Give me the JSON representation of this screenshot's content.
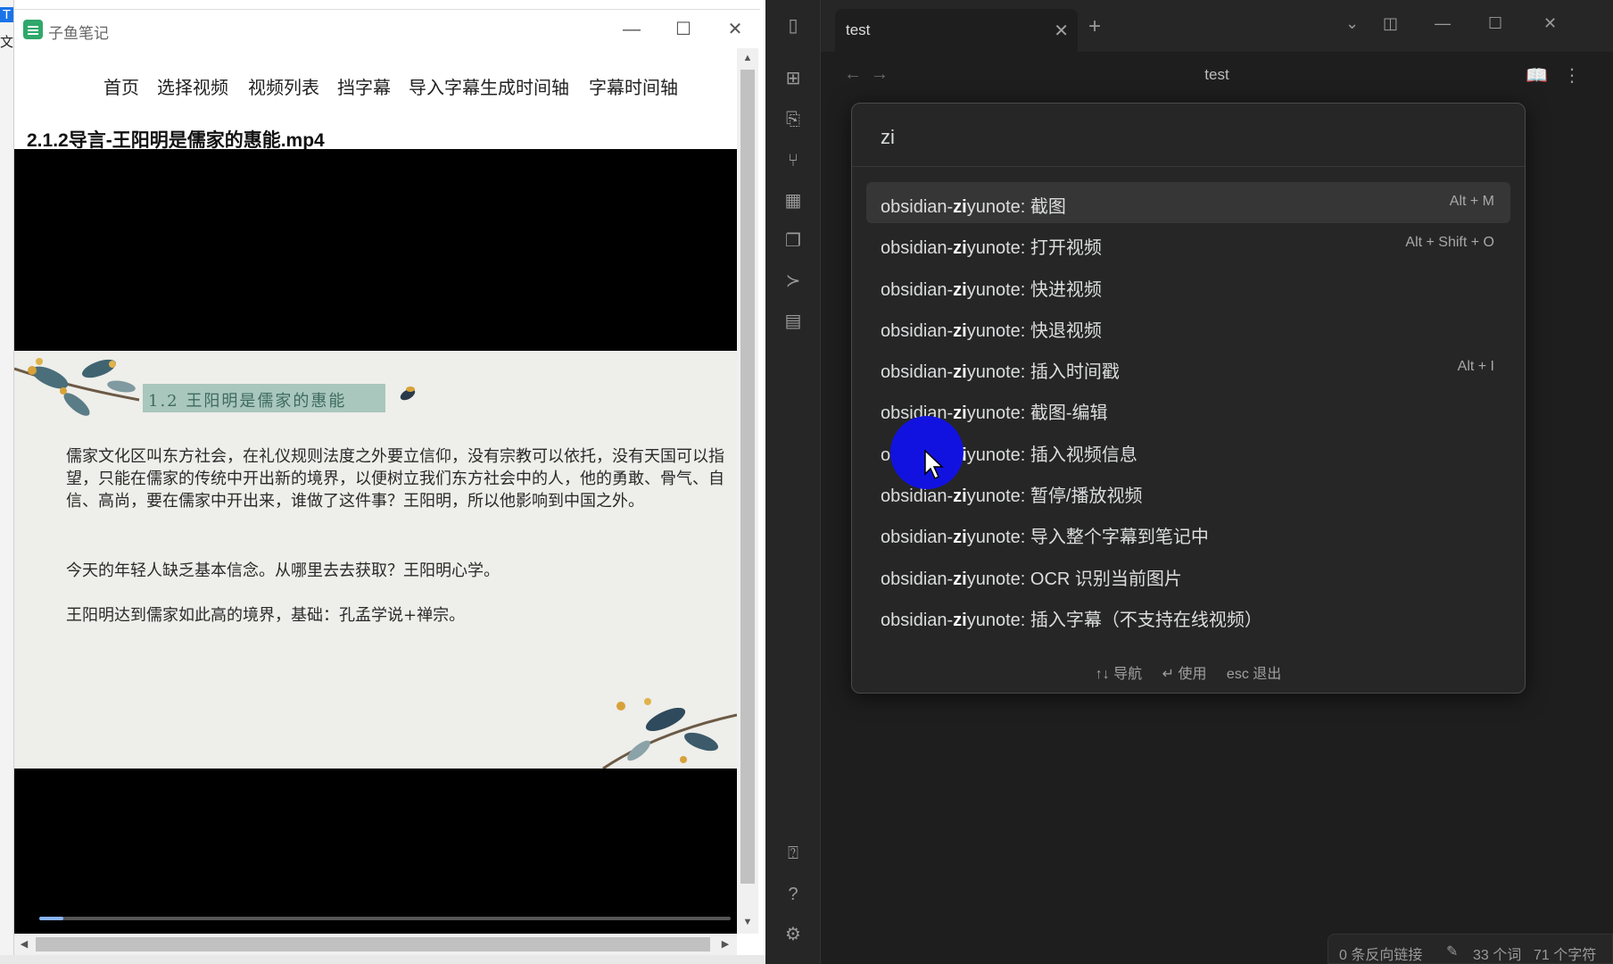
{
  "left_app": {
    "title": "子鱼笔记",
    "edge_chars": [
      "T",
      "文"
    ],
    "nav": [
      "首页",
      "选择视频",
      "视频列表",
      "挡字幕",
      "导入字幕生成时间轴",
      "字幕时间轴"
    ],
    "video_title": "2.1.2导言-王阳明是儒家的惠能.mp4",
    "slide": {
      "heading": "1.2 王阳明是儒家的惠能",
      "paragraph_1": "儒家文化区叫东方社会，在礼仪规则法度之外要立信仰，没有宗教可以依托，没有天国可以指望，只能在儒家的传统中开出新的境界，以便树立我们东方社会中的人，他的勇敢、骨气、自信、高尚，要在儒家中开出来，谁做了这件事？王阳明，所以他影响到中国之外。",
      "paragraph_2": "今天的年轻人缺乏基本信念。从哪里去去获取？王阳明心学。",
      "paragraph_3": "王阳明达到儒家如此高的境界，基础：孔孟学说+禅宗。"
    },
    "playback_progress": 0.035
  },
  "obsidian": {
    "tab": {
      "label": "test"
    },
    "view_title": "test",
    "palette": {
      "query": "zi",
      "commands": [
        {
          "prefix": "obsidian-",
          "match": "zi",
          "suffix": "yunote: 截图",
          "hotkey": "Alt + M"
        },
        {
          "prefix": "obsidian-",
          "match": "zi",
          "suffix": "yunote: 打开视频",
          "hotkey": "Alt + Shift + O"
        },
        {
          "prefix": "obsidian-",
          "match": "zi",
          "suffix": "yunote: 快进视频",
          "hotkey": ""
        },
        {
          "prefix": "obsidian-",
          "match": "zi",
          "suffix": "yunote: 快退视频",
          "hotkey": ""
        },
        {
          "prefix": "obsidian-",
          "match": "zi",
          "suffix": "yunote: 插入时间戳",
          "hotkey": "Alt + I"
        },
        {
          "prefix": "obsidian-",
          "match": "zi",
          "suffix": "yunote: 截图-编辑",
          "hotkey": ""
        },
        {
          "prefix": "obsidian-",
          "match": "zi",
          "suffix": "yunote: 插入视频信息",
          "hotkey": ""
        },
        {
          "prefix": "obsidian-",
          "match": "zi",
          "suffix": "yunote: 暂停/播放视频",
          "hotkey": ""
        },
        {
          "prefix": "obsidian-",
          "match": "zi",
          "suffix": "yunote: 导入整个字幕到笔记中",
          "hotkey": ""
        },
        {
          "prefix": "obsidian-",
          "match": "zi",
          "suffix": "yunote: OCR 识别当前图片",
          "hotkey": ""
        },
        {
          "prefix": "obsidian-",
          "match": "zi",
          "suffix": "yunote: 插入字幕（不支持在线视频）",
          "hotkey": ""
        }
      ],
      "footer": {
        "navigate": "↑↓ 导航",
        "use": "↵ 使用",
        "exit": "esc 退出"
      }
    },
    "status": {
      "backlinks": "0 条反向链接",
      "words": "33 个词",
      "chars": "71 个字符"
    }
  }
}
